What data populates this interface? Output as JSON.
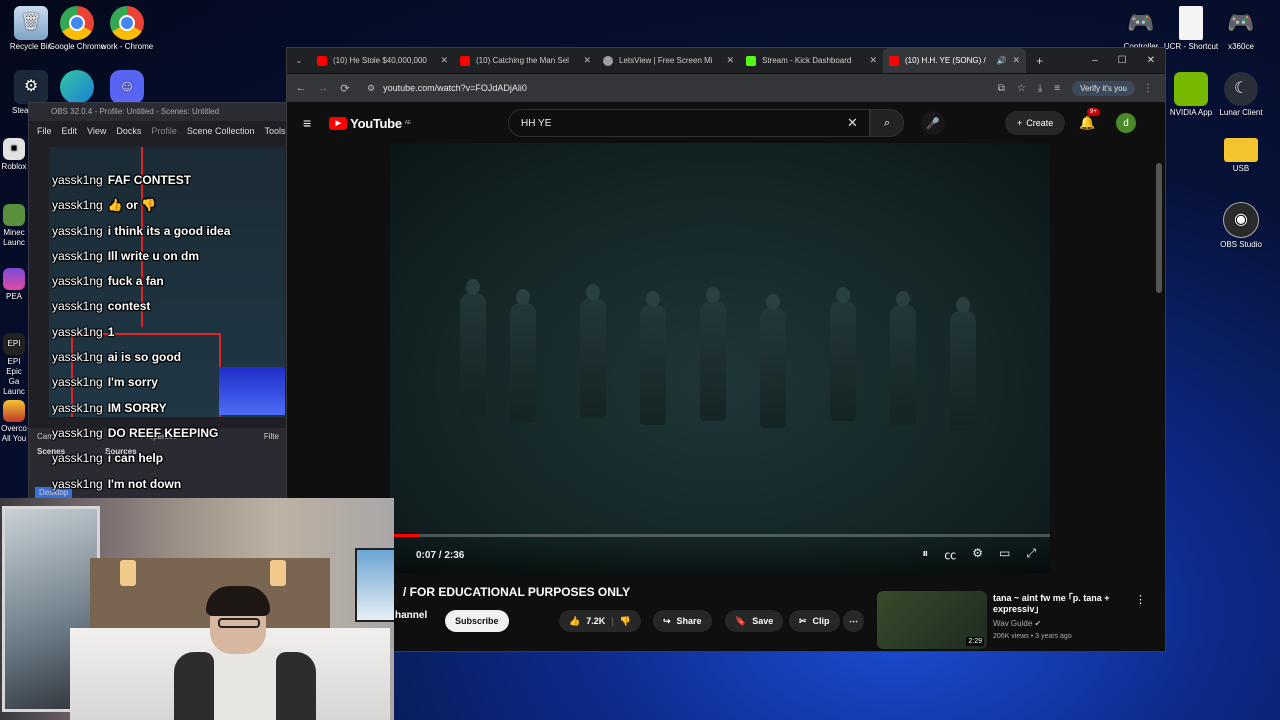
{
  "desktop_icons_left": [
    {
      "label": "Recycle Bin",
      "icon": "recycle-bin-icon"
    },
    {
      "label": "Google Chrome",
      "icon": "chrome-icon"
    },
    {
      "label": "work - Chrome",
      "icon": "chrome-icon"
    },
    {
      "label": "Steam",
      "icon": "steam-icon"
    },
    {
      "label": "Discord",
      "icon": "discord-icon"
    }
  ],
  "desktop_icons_right": [
    {
      "label": "Controller",
      "icon": "gamepad-icon"
    },
    {
      "label": "UCR - Shortcut",
      "icon": "file-icon"
    },
    {
      "label": "x360ce",
      "icon": "gamepad-icon"
    },
    {
      "label": "NVIDIA App",
      "icon": "nvidia-icon"
    },
    {
      "label": "Lunar Client",
      "icon": "lunar-icon"
    },
    {
      "label": "USB",
      "icon": "folder-icon"
    },
    {
      "label": "OBS Studio",
      "icon": "obs-icon"
    }
  ],
  "desktop_partial_labels": [
    "Steam",
    "Roblox",
    "Minec Launc",
    "PEA",
    "EPI Epic Ga Launc",
    "Overco All You"
  ],
  "obs": {
    "title": "OBS 32.0.4 - Profile: Untitled - Scenes: Untitled",
    "menu": [
      "File",
      "Edit",
      "View",
      "Docks",
      "Profile",
      "Scene Collection",
      "Tools"
    ],
    "cam_label": "Cam",
    "properties_label": "Properties",
    "filters_label": "Filte",
    "scenes_label": "Scenes",
    "sources_label": "Sources",
    "desktop_tag": "Desktop"
  },
  "chat": [
    {
      "user": "yassk1ng",
      "text": "FAF CONTEST"
    },
    {
      "user": "yassk1ng",
      "text": "👍 or 👎"
    },
    {
      "user": "yassk1ng",
      "text": "i think its a good idea"
    },
    {
      "user": "yassk1ng",
      "text": "Ill write u on dm"
    },
    {
      "user": "yassk1ng",
      "text": "fuck a fan"
    },
    {
      "user": "yassk1ng",
      "text": "contest"
    },
    {
      "user": "yassk1ng",
      "text": "1"
    },
    {
      "user": "yassk1ng",
      "text": "ai is so good"
    },
    {
      "user": "yassk1ng",
      "text": "I'm sorry"
    },
    {
      "user": "yassk1ng",
      "text": "IM SORRY"
    },
    {
      "user": "yassk1ng",
      "text": "DO REEF KEEPING"
    },
    {
      "user": "yassk1ng",
      "text": "i can help"
    },
    {
      "user": "yassk1ng",
      "text": "I'm not down"
    }
  ],
  "browser": {
    "tabs": [
      {
        "title": "(10) He Stole $40,000,000",
        "color": "#ff0000",
        "active": false
      },
      {
        "title": "(10) Catching the Man Sel",
        "color": "#ff0000",
        "active": false
      },
      {
        "title": "LetsView | Free Screen Mi",
        "color": "#9aa0a6",
        "active": false
      },
      {
        "title": "Stream - Kick Dashboard",
        "color": "#53fc18",
        "active": false
      },
      {
        "title": "(10) H.H. YE (SONG) /",
        "color": "#ff0000",
        "active": true
      }
    ],
    "url": "youtube.com/watch?v=FOJdADjAli0",
    "verify_label": "Verify it's you"
  },
  "youtube": {
    "logo_text": "YouTube",
    "logo_region": "AE",
    "search_value": "HH YE",
    "create_label": "Create",
    "notif_badge": "9+",
    "avatar_letter": "d",
    "time": "0:07 / 2:36",
    "progress": 0.045,
    "video_title": "/ FOR EDUCATIONAL PURPOSES ONLY",
    "channel_name": "hannel",
    "subscribe_label": "Subscribe",
    "like_count": "7.2K",
    "share_label": "Share",
    "save_label": "Save",
    "clip_label": "Clip",
    "recommendation": {
      "title": "tana ~ aint fw me ｢p. tana + expressiv｣",
      "channel": "Wav Guide",
      "meta": "206K views • 3 years ago",
      "duration": "2:29"
    }
  }
}
